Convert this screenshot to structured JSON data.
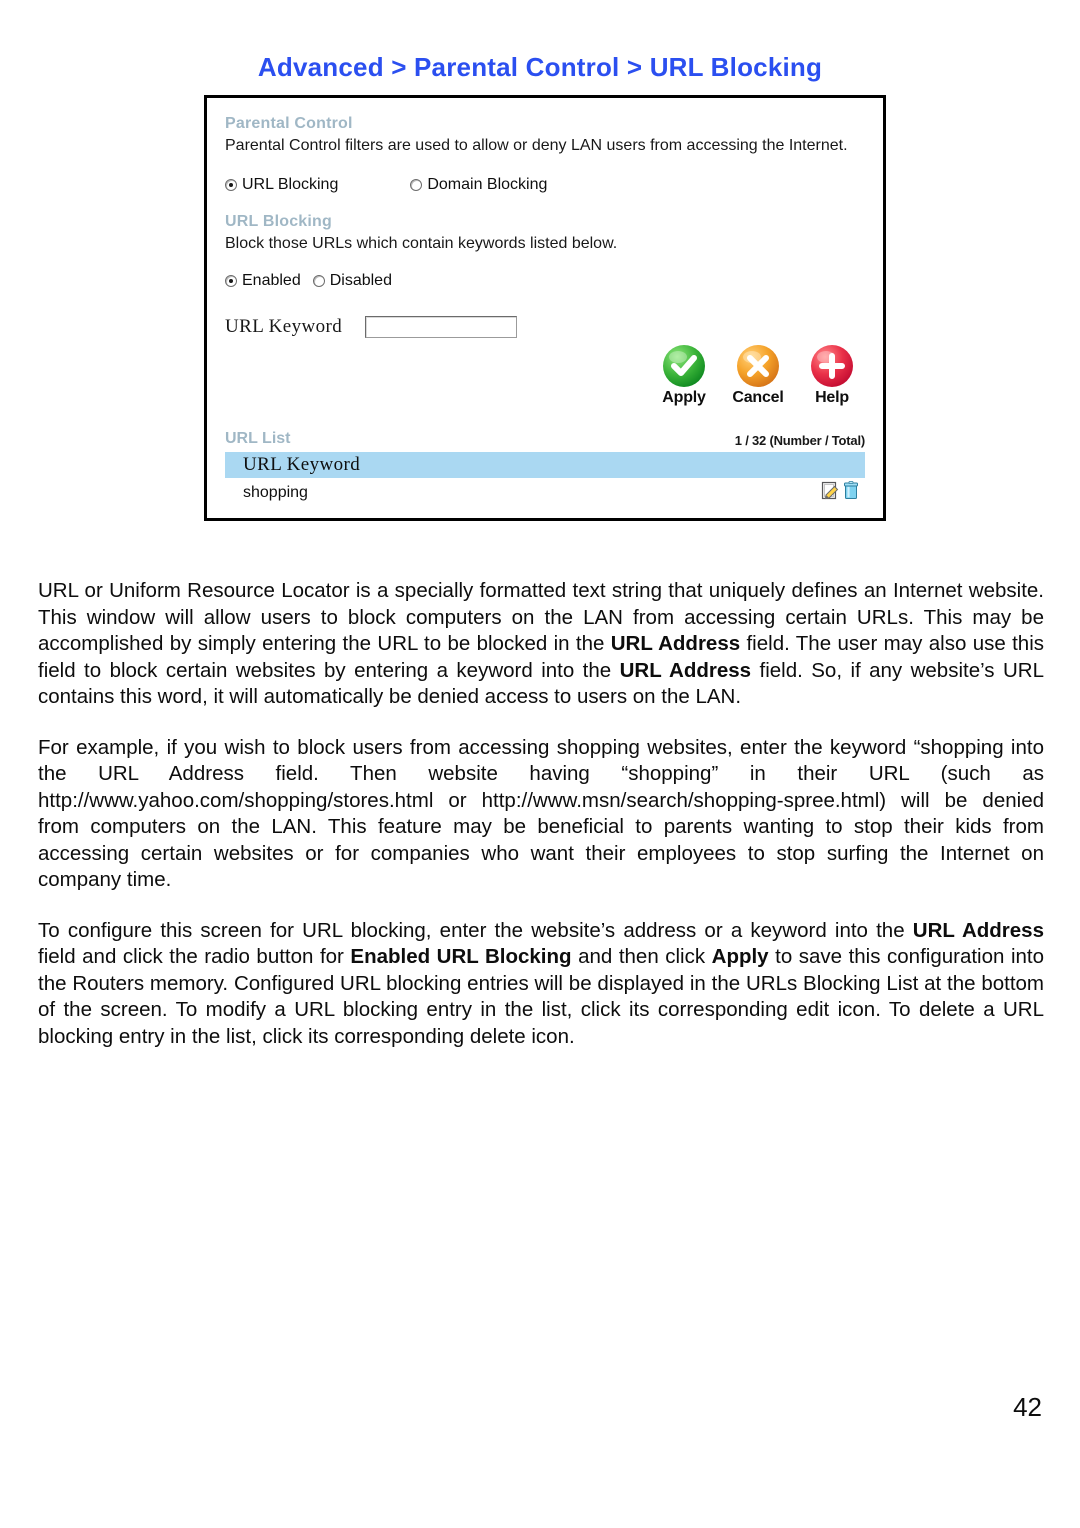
{
  "page": {
    "title": "Advanced > Parental Control > URL Blocking",
    "title_color": "#2b4ff0",
    "number": "42"
  },
  "screenshot": {
    "parental_control": {
      "heading": "Parental Control",
      "description": "Parental Control filters are used to allow or deny LAN users from accessing the Internet.",
      "options": [
        {
          "label": "URL Blocking",
          "selected": true
        },
        {
          "label": "Domain Blocking",
          "selected": false
        }
      ]
    },
    "url_blocking": {
      "heading": "URL Blocking",
      "description": "Block those URLs which contain keywords listed below.",
      "options": [
        {
          "label": "Enabled",
          "selected": true
        },
        {
          "label": "Disabled",
          "selected": false
        }
      ],
      "keyword_field": {
        "label": "URL Keyword",
        "value": "",
        "placeholder": ""
      }
    },
    "actions": [
      {
        "label": "Apply",
        "icon": "check-circle-icon",
        "color": "#2ea82c"
      },
      {
        "label": "Cancel",
        "icon": "x-circle-icon",
        "color": "#f0a02a"
      },
      {
        "label": "Help",
        "icon": "plus-circle-icon",
        "color": "#dc1f3f"
      }
    ],
    "url_list": {
      "title": "URL List",
      "count": "1 / 32 (Number / Total)",
      "column_header": "URL Keyword",
      "header_bg": "#a9d6f0",
      "rows": [
        {
          "keyword": "shopping",
          "edit_icon": "edit-icon",
          "delete_icon": "trash-icon"
        }
      ]
    }
  },
  "body": {
    "paragraph_1_part_1": "URL or Uniform Resource Locator is a specially formatted text string that uniquely defines an Internet website. This window will allow users to block computers on the LAN from accessing certain URLs. This may be accomplished by simply entering the URL to be blocked in the ",
    "paragraph_1_bold_1": "URL Address",
    "paragraph_1_part_2": " field. The user may also use this field to block certain websites by entering a keyword into the ",
    "paragraph_1_bold_2": "URL Address",
    "paragraph_1_part_3": " field. So, if any website’s URL contains this word, it will automatically be denied access to users on the LAN.",
    "paragraph_2": "For example, if you wish to block users from accessing shopping websites, enter the keyword “shopping into the URL Address field. Then website having “shopping” in their URL (such as http://www.yahoo.com/shopping/stores.html  or  http://www.msn/search/shopping-spree.html)  will be denied from computers on the LAN. This feature may be beneficial to parents wanting to stop their kids from accessing certain websites or for companies who want their employees to stop surfing the Internet on company time.",
    "paragraph_3_part_1": "To configure this screen for URL blocking, enter the website’s address or a keyword into the ",
    "paragraph_3_bold_1": "URL Address",
    "paragraph_3_part_2": " field and click the radio button for ",
    "paragraph_3_bold_2": "Enabled URL Blocking",
    "paragraph_3_part_3": " and then click ",
    "paragraph_3_bold_3": "Apply",
    "paragraph_3_part_4": " to save this configuration into the Routers memory. Configured URL blocking entries will be displayed in the URLs Blocking List at the bottom of the screen. To modify a URL blocking entry in the list, click its corresponding edit icon. To delete a URL blocking entry in the list, click its corresponding delete icon."
  }
}
